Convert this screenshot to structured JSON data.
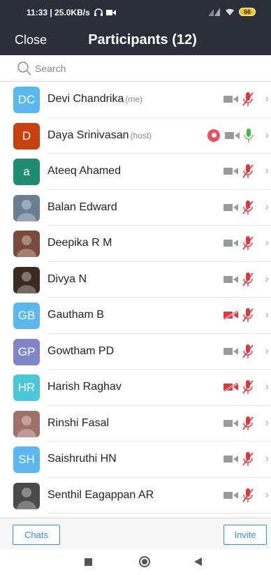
{
  "status_bar": {
    "text": "11:33 | 25.0KB/s",
    "battery": "66"
  },
  "header": {
    "close_label": "Close",
    "title": "Participants (12)"
  },
  "search": {
    "placeholder": "Search"
  },
  "participants": [
    {
      "name": "Devi Chandrika",
      "tag": "(me)",
      "initials": "DC",
      "avatar_color": "#5ab7f0",
      "avatar_type": "initials",
      "video_off": false,
      "recording": false,
      "mic": "muted"
    },
    {
      "name": "Daya Srinivasan",
      "tag": "(host)",
      "initials": "D",
      "avatar_color": "#c9400f",
      "avatar_type": "initials",
      "video_off": false,
      "recording": true,
      "mic": "on"
    },
    {
      "name": "Ateeq Ahamed",
      "tag": "",
      "initials": "a",
      "avatar_color": "#1f8b6f",
      "avatar_type": "initials",
      "video_off": false,
      "recording": false,
      "mic": "muted"
    },
    {
      "name": "Balan Edward",
      "tag": "",
      "initials": "",
      "avatar_color": "#6b7f93",
      "avatar_type": "photo",
      "video_off": false,
      "recording": false,
      "mic": "muted"
    },
    {
      "name": "Deepika R M",
      "tag": "",
      "initials": "",
      "avatar_color": "#7a4b3a",
      "avatar_type": "photo",
      "video_off": false,
      "recording": false,
      "mic": "muted"
    },
    {
      "name": "Divya N",
      "tag": "",
      "initials": "",
      "avatar_color": "#3a2a22",
      "avatar_type": "photo",
      "video_off": false,
      "recording": false,
      "mic": "muted"
    },
    {
      "name": "Gautham B",
      "tag": "",
      "initials": "GB",
      "avatar_color": "#5ab7f0",
      "avatar_type": "initials",
      "video_off": true,
      "recording": false,
      "mic": "muted"
    },
    {
      "name": "Gowtham PD",
      "tag": "",
      "initials": "GP",
      "avatar_color": "#7f86c9",
      "avatar_type": "initials",
      "video_off": false,
      "recording": false,
      "mic": "muted"
    },
    {
      "name": "Harish Raghav",
      "tag": "",
      "initials": "HR",
      "avatar_color": "#49c8d8",
      "avatar_type": "initials",
      "video_off": true,
      "recording": false,
      "mic": "muted"
    },
    {
      "name": "Rinshi Fasal",
      "tag": "",
      "initials": "",
      "avatar_color": "#a0706a",
      "avatar_type": "photo",
      "video_off": false,
      "recording": false,
      "mic": "muted"
    },
    {
      "name": "Saishruthi HN",
      "tag": "",
      "initials": "SH",
      "avatar_color": "#5ab7f0",
      "avatar_type": "initials",
      "video_off": false,
      "recording": false,
      "mic": "muted"
    },
    {
      "name": "Senthil Eagappan AR",
      "tag": "",
      "initials": "",
      "avatar_color": "#4a4a4a",
      "avatar_type": "photo",
      "video_off": false,
      "recording": false,
      "mic": "muted"
    }
  ],
  "footer": {
    "chats_label": "Chats",
    "invite_label": "Invite"
  },
  "colors": {
    "header_bg": "#2b2f3a",
    "accent": "#2d8cff",
    "muted_red": "#e0373f",
    "mic_green": "#3fbf3f",
    "icon_grey": "#9a9a9a"
  }
}
